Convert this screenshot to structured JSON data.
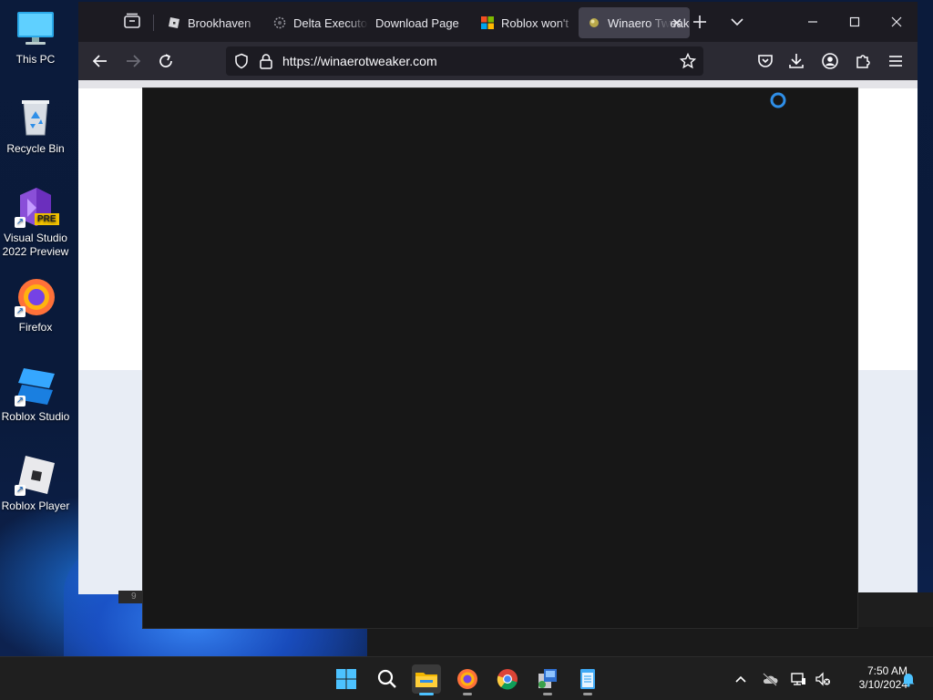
{
  "desktop": {
    "icons": [
      {
        "label": "This PC"
      },
      {
        "label": "Recycle Bin"
      },
      {
        "label": "Visual Studio 2022 Preview",
        "badge": "PRE"
      },
      {
        "label": "Firefox"
      },
      {
        "label": "Roblox Studio"
      },
      {
        "label": "Roblox Player"
      }
    ]
  },
  "browser": {
    "tabs": [
      {
        "title": "Brookhaven",
        "icon": "roblox-icon",
        "active": false
      },
      {
        "title": "Delta Executor",
        "icon": "delta-icon",
        "active": false
      },
      {
        "title": "Download Page",
        "icon": "",
        "active": false
      },
      {
        "title": "Roblox won't",
        "icon": "microsoft-icon",
        "active": false
      },
      {
        "title": "Winaero Tweaker",
        "icon": "winaero-icon",
        "active": true
      }
    ],
    "url": "https://winaerotweaker.com",
    "colors": {
      "tabbar": "#1c1b22",
      "navbar": "#2b2a33",
      "active_tab": "#42414d",
      "spinner": "#2f8fe8"
    }
  },
  "page": {
    "underlying_fragment": "9"
  },
  "taskbar": {
    "pinned": [
      "windows-start-icon",
      "search-icon",
      "file-explorer-icon",
      "firefox-icon",
      "chrome-icon",
      "setup-installer-icon",
      "notepad-icon"
    ],
    "clock": {
      "time": "7:50 AM",
      "date": "3/10/2024"
    }
  }
}
